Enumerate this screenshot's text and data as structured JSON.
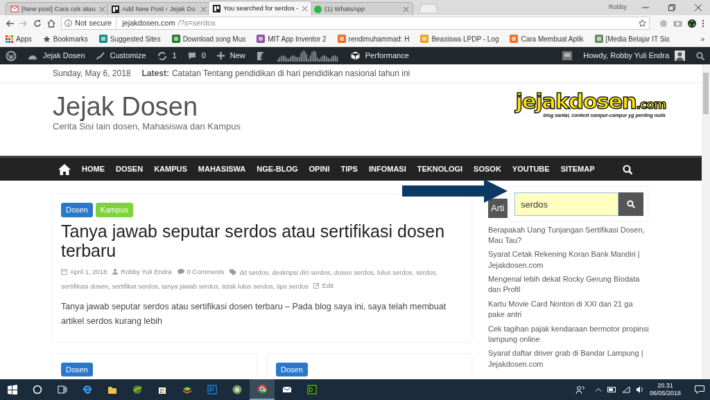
{
  "browser": {
    "tabs": [
      {
        "title": "[New post] Cara cek atau",
        "kind": "mail",
        "selected": false
      },
      {
        "title": "Add New Post ‹ Jejak Do",
        "kind": "site",
        "selected": false
      },
      {
        "title": "You searched for serdos -",
        "kind": "site",
        "selected": true
      },
      {
        "title": "(1) WhatsApp",
        "kind": "chat",
        "selected": false
      }
    ],
    "profile": "Robby",
    "address": {
      "security": "Not secure",
      "host": "jejakdosen.com",
      "path": "/?s=serdos"
    },
    "bookmarks": [
      {
        "label": "Apps",
        "kind": "apps"
      },
      {
        "label": "Bookmarks",
        "kind": "star"
      },
      {
        "label": "Suggested Sites",
        "kind": "favicon",
        "color": "#138a8a"
      },
      {
        "label": "Download song Mus",
        "kind": "favicon",
        "color": "#1e7a2e"
      },
      {
        "label": "MIT App Inventor 2",
        "kind": "favicon",
        "color": "#8a4fa0"
      },
      {
        "label": "rendimuhammad: H",
        "kind": "favicon",
        "color": "#f26b1d"
      },
      {
        "label": "Beasiswa LPDP - Log",
        "kind": "favicon",
        "color": "#e8a317"
      },
      {
        "label": "Cara Membuat Aplik",
        "kind": "favicon",
        "color": "#f26b1d"
      },
      {
        "label": "[Media Belajar IT Sis",
        "kind": "favicon",
        "color": "#6a8c5a"
      }
    ],
    "more": "»"
  },
  "admin_bar": {
    "items": [
      {
        "kind": "wp"
      },
      {
        "kind": "site",
        "label": "Jejak Dosen"
      },
      {
        "kind": "brush",
        "label": "Customize"
      },
      {
        "kind": "updates",
        "label": "1"
      },
      {
        "kind": "comments",
        "label": "0"
      },
      {
        "kind": "plus",
        "label": "New"
      },
      {
        "kind": "seo"
      },
      {
        "kind": "stats"
      },
      {
        "kind": "cube",
        "label": "Performance"
      }
    ],
    "howdy": "Howdy, Robby Yuli Endra"
  },
  "site": {
    "date": "Sunday, May 6, 2018",
    "latest_label": "Latest:",
    "latest": "Catatan Tentang pendidikan di hari pendidikan nasional tahun ini",
    "title": "Jejak Dosen",
    "tagline": "Cerita Sisi lain dosen, Mahasiswa dan Kampus",
    "logo": {
      "name": "jejakdosen",
      "suffix": ".com",
      "motto": "blog santai, content campur-campur yg penting nulis"
    },
    "nav": [
      "HOME",
      "DOSEN",
      "KAMPUS",
      "MAHASISWA",
      "NGE-BLOG",
      "OPINI",
      "TIPS",
      "INFOMASI",
      "TEKNOLOGI",
      "SOSOK",
      "YOUTUBE",
      "SITEMAP"
    ]
  },
  "search": {
    "value": "serdos"
  },
  "post": {
    "categories": [
      {
        "label": "Dosen",
        "color": "#2a78c8"
      },
      {
        "label": "Kampus",
        "color": "#7ed33b"
      }
    ],
    "title": "Tanya jawab seputar serdos atau sertifikasi dosen terbaru",
    "date": "April 1, 2018",
    "author": "Robby Yuli Endra",
    "comments": "0 Comments",
    "tags": [
      "dd serdos,",
      "deskripsi diri serdos,",
      "dosen serdos,",
      "lulus serdos,",
      "serdos,",
      "sertifikasi dosen,",
      "sertifikat serdos,",
      "tanya jawab serdos,",
      "tidak lulus serdos,",
      "tips serdos"
    ],
    "edit": "Edit",
    "excerpt": "Tanya jawab seputar serdos atau sertifikasi dosen terbaru – Pada blog saya ini, saya telah membuat artikel serdos kurang lebih"
  },
  "more_posts": [
    {
      "categories": [
        {
          "label": "Dosen",
          "color": "#2a78c8"
        }
      ]
    },
    {
      "categories": [
        {
          "label": "Dosen",
          "color": "#2a78c8"
        }
      ]
    }
  ],
  "sidebar": {
    "title": "Arti",
    "links": [
      "Berapakah Uang Tunjangan Sertifikasi Dosen, Mau Tau?",
      "Syarat Cetak Rekening Koran Bank Mandiri | Jejakdosen.com",
      "Mengenal lebih dekat Rocky Gerung Biodata dan Profil",
      "Kartu Movie Card Nonton di XXI dan 21 ga pake antri",
      "Cek tagihan pajak kendaraan bermotor propinsi lampung online",
      "Syarat daftar driver grab di Bandar Lampung | Jejakdosen.com"
    ]
  },
  "taskbar": {
    "apps": [
      {
        "kind": "start",
        "selected": false
      },
      {
        "kind": "cortana",
        "selected": false
      },
      {
        "kind": "taskview",
        "selected": false
      },
      {
        "kind": "edge",
        "selected": false
      },
      {
        "kind": "folder",
        "selected": false
      },
      {
        "kind": "globe",
        "selected": false
      },
      {
        "kind": "store",
        "selected": false
      },
      {
        "kind": "stack",
        "selected": false
      },
      {
        "kind": "ps",
        "selected": false
      },
      {
        "kind": "android",
        "selected": false
      },
      {
        "kind": "chrome",
        "selected": true
      },
      {
        "kind": "mail",
        "selected": false
      },
      {
        "kind": "dw",
        "selected": false
      }
    ],
    "time": "20.31",
    "date": "06/05/2018"
  }
}
